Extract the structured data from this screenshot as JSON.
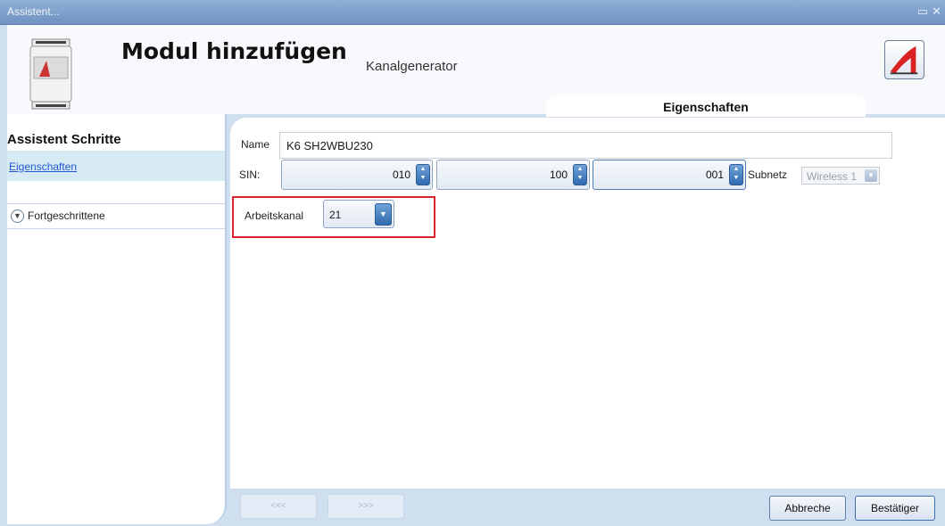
{
  "window": {
    "title": "Assistent..."
  },
  "header": {
    "title": "Modul hinzufügen",
    "subtitle": "Kanalgenerator",
    "tab_label": "Eigenschaften"
  },
  "sidebar": {
    "title": "Assistent Schritte",
    "steps": [
      {
        "label": "Eigenschaften",
        "selected": true
      }
    ],
    "advanced_label": "Fortgeschrittene"
  },
  "form": {
    "name_label": "Name",
    "name_value": "K6 SH2WBU230",
    "sin_label": "SIN:",
    "sin_values": [
      "010",
      "100",
      "001"
    ],
    "subnet_label": "Subnetz",
    "subnet_value": "Wireless 1",
    "channel_label": "Arbeitskanal",
    "channel_value": "21"
  },
  "footer": {
    "prev_label": "<<<",
    "next_label": ">>>",
    "cancel_label": "Abbreche",
    "confirm_label": "Bestätiger"
  },
  "colors": {
    "titlebar": "#7f9fcb",
    "highlight": "#d9232e",
    "link": "#1f55d6",
    "selected_step": "#d7ebf4"
  }
}
